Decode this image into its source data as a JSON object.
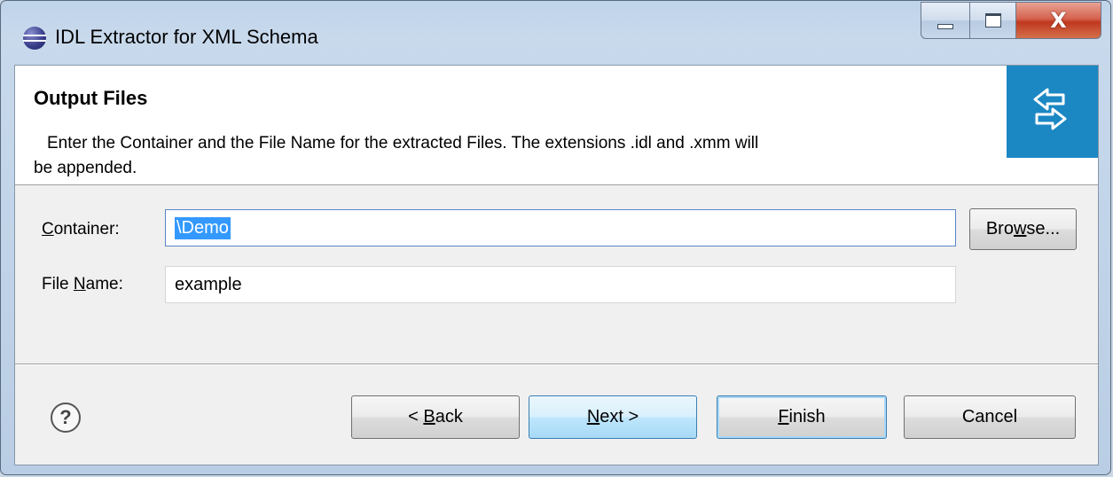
{
  "window": {
    "title": "IDL Extractor for XML Schema",
    "app_icon": "eclipse-icon",
    "minimize_icon": "minimize-icon",
    "maximize_icon": "maximize-icon",
    "close_glyph": "X"
  },
  "header": {
    "title": "Output Files",
    "description_line1": "Enter the Container and the File Name for the extracted Files. The extensions .idl and .xmm will",
    "description_line2": "be appended.",
    "banner_icon": "wizard-arrows-icon",
    "banner_color": "#1b87c3"
  },
  "form": {
    "container": {
      "label_pre": "",
      "label_u": "C",
      "label_post": "ontainer:",
      "value": "\\Demo"
    },
    "filename": {
      "label_pre": "File ",
      "label_u": "N",
      "label_post": "ame:",
      "value": "example"
    },
    "browse": {
      "pre": "Bro",
      "u": "w",
      "post": "se..."
    }
  },
  "footer": {
    "help_icon": "help-icon",
    "help_glyph": "?",
    "back": {
      "pre": "< ",
      "u": "B",
      "post": "ack"
    },
    "next": {
      "pre": "",
      "u": "N",
      "post": "ext >"
    },
    "finish": {
      "pre": "",
      "u": "F",
      "post": "inish"
    },
    "cancel": {
      "label": "Cancel"
    }
  }
}
